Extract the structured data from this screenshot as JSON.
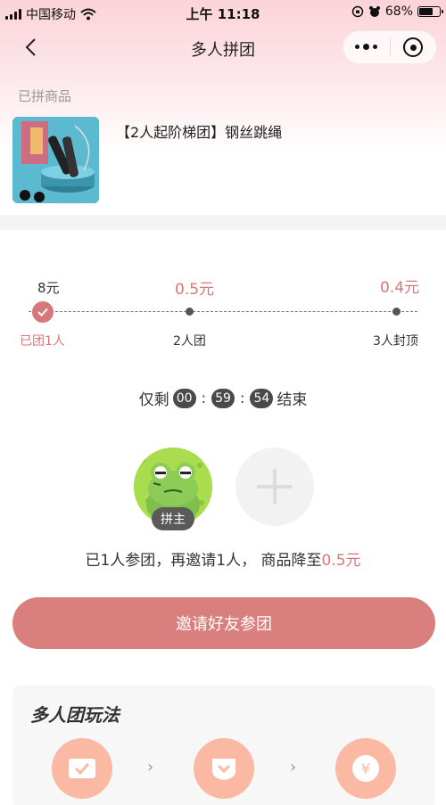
{
  "status_bar": {
    "carrier": "中国移动",
    "time": "上午 11:18",
    "battery": "68%",
    "battery_level": 0.68
  },
  "nav": {
    "title": "多人拼团"
  },
  "product_section": {
    "label": "已拼商品",
    "title": "【2人起阶梯团】钢丝跳绳"
  },
  "ladder": {
    "tiers": [
      {
        "price": "8元",
        "label": "已团1人",
        "active": true
      },
      {
        "price": "0.5元",
        "label": "2人团",
        "active": false
      },
      {
        "price": "0.4元",
        "label": "3人封顶",
        "active": false
      }
    ]
  },
  "countdown": {
    "prefix": "仅剩",
    "hours": "00",
    "minutes": "59",
    "seconds": "54",
    "suffix": "结束"
  },
  "members": {
    "host_badge": "拼主"
  },
  "invite_info": {
    "text_before": "已1人参团，再邀请1人，  商品降至",
    "price": "0.5元"
  },
  "invite_button": {
    "label": "邀请好友参团"
  },
  "rules": {
    "title": "多人团玩法"
  },
  "colors": {
    "accent": "#d4787a",
    "button": "#d9807f",
    "step_circle": "#fbb9a3"
  }
}
